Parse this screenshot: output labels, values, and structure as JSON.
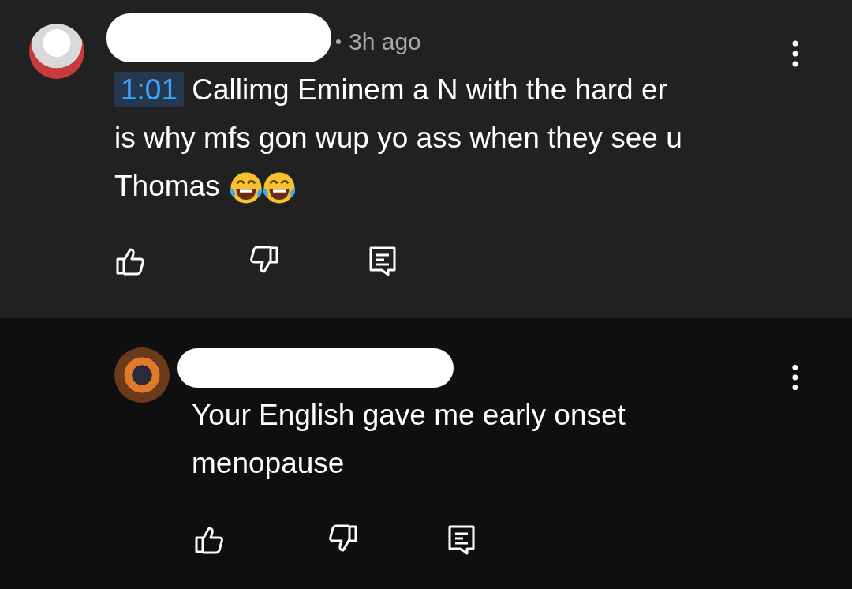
{
  "comments": [
    {
      "kind": "top",
      "time": "3h ago",
      "timestamp": "1:01",
      "lines": [
        "Callimg Eminem a N with the hard er",
        "is why mfs gon wup yo ass when they see u",
        "Thomas"
      ],
      "emojis": [
        {
          "kind": "laughing"
        },
        {
          "kind": "laughing"
        }
      ]
    },
    {
      "kind": "reply",
      "lines": [
        "Your English gave me early onset",
        "menopause"
      ]
    }
  ]
}
